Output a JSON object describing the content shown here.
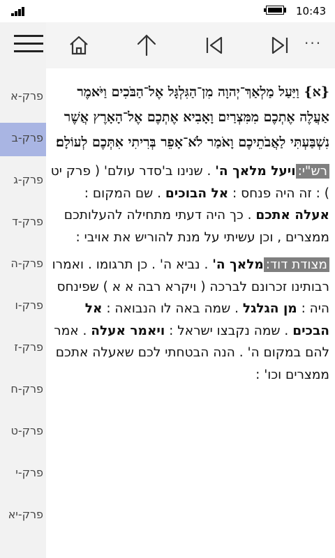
{
  "status_bar": {
    "time": "10:43"
  },
  "sidebar": {
    "chapters": [
      {
        "label": "פרק-א"
      },
      {
        "label": "פרק-ב"
      },
      {
        "label": "פרק-ג"
      },
      {
        "label": "פרק-ד"
      },
      {
        "label": "פרק-ה"
      },
      {
        "label": "פרק-ו"
      },
      {
        "label": "פרק-ז"
      },
      {
        "label": "פרק-ח"
      },
      {
        "label": "פרק-ט"
      },
      {
        "label": "פרק-י"
      },
      {
        "label": "פרק-יא"
      }
    ],
    "selected_index": 1
  },
  "toolbar": {
    "icons": [
      "home-icon",
      "up-arrow-icon",
      "previous-icon",
      "next-icon"
    ],
    "more_label": "···"
  },
  "content": {
    "verse": "{א} וַיַּעַל מַלְאַךְ־יְהוָה מִן־הַגִּלְגָּל אֶל־הַבֹּכִים וַיֹּאמֶר אַעֲלֶה אֶתְכֶם מִמִּצְרַיִם וָאָבִיא אֶתְכֶם אֶל־הָאָרֶץ אֲשֶׁר נִשְׁבַּעְתִּי לַאֲבֹתֵיכֶם וָאֹמַר לֹא־אָפֵר בְּרִיתִי אִתְּכֶם לְעוֹלָם׃",
    "rashi": {
      "label": "רש\"י:",
      "parts": [
        {
          "text": "ויעל מלאך ה'",
          "bold": true
        },
        {
          "text": " . שנינו ב'סדר עולם' ( פרק יט ) : זה היה פנחס : ",
          "bold": false
        },
        {
          "text": "אל הבוכים",
          "bold": true
        },
        {
          "text": " . שם המקום : ",
          "bold": false
        },
        {
          "text": "אעלה אתכם",
          "bold": true
        },
        {
          "text": " . כך היה דעתי מתחילה להעלותכם ממצרים , וכן עשיתי על מנת להוריש את אויבי :",
          "bold": false
        }
      ]
    },
    "metzudat": {
      "label": "מצודת דוד:",
      "parts": [
        {
          "text": "מלאך ה'",
          "bold": true
        },
        {
          "text": " . נביא ה' . כן תרגומו . ואמרו רבותינו זכרונם לברכה ( ויקרא רבה א א ) שפינחס היה : ",
          "bold": false
        },
        {
          "text": "מן הגלגל",
          "bold": true
        },
        {
          "text": " . שמה באה לו הנבואה : ",
          "bold": false
        },
        {
          "text": "אל הבכים",
          "bold": true
        },
        {
          "text": " . שמה נקבצו ישראל : ",
          "bold": false
        },
        {
          "text": "ויאמר אעלה",
          "bold": true
        },
        {
          "text": " . אמר להם במקום ה' . הנה הבטחתי לכם שאעלה אתכם ממצרים וכו' :",
          "bold": false
        }
      ]
    }
  }
}
